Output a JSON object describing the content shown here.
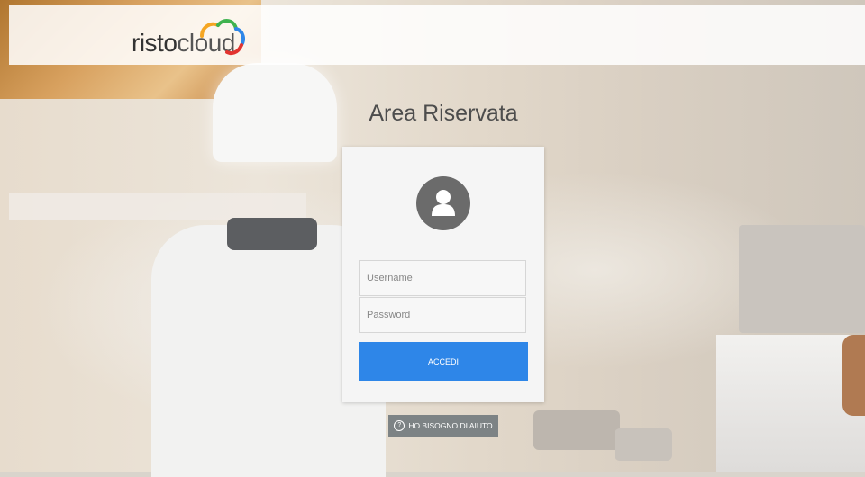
{
  "header": {
    "logo_text": "risto",
    "logo_cloud_text": "cloud"
  },
  "page": {
    "title": "Area Riservata"
  },
  "login": {
    "username_placeholder": "Username",
    "password_placeholder": "Password",
    "submit_label": "ACCEDI",
    "help_label": "HO BISOGNO DI AIUTO",
    "help_icon_glyph": "?"
  },
  "colors": {
    "accent": "#2e86e8",
    "help_button": "#7d8385",
    "avatar": "#6b6b6b"
  },
  "icons": {
    "avatar": "user-icon",
    "help": "question-circle-icon"
  }
}
